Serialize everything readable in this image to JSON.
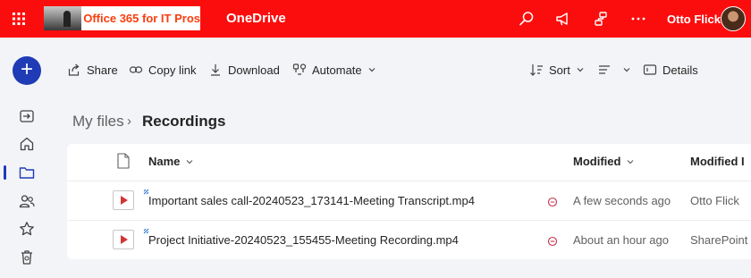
{
  "topbar": {
    "logo_text": "Office 365 for IT Pros",
    "app_title": "OneDrive",
    "user_name": "Otto Flick",
    "icons": [
      "waffle-icon",
      "search-icon",
      "megaphone-icon",
      "diagram-icon",
      "more-icon"
    ]
  },
  "rail": {
    "new_label": "+",
    "items": [
      "home-exit-icon",
      "home-icon",
      "folder-icon",
      "people-icon",
      "star-icon",
      "recycle-bin-icon"
    ]
  },
  "command_bar": {
    "share": "Share",
    "copy_link": "Copy link",
    "download": "Download",
    "automate": "Automate",
    "sort": "Sort",
    "details": "Details"
  },
  "breadcrumb": {
    "parent": "My files",
    "separator": "›",
    "current": "Recordings"
  },
  "list": {
    "columns": {
      "name": "Name",
      "modified": "Modified",
      "modified_by": "Modified I"
    },
    "rows": [
      {
        "name": "Important sales call-20240523_173141-Meeting Transcript.mp4",
        "modified": "A few seconds ago",
        "modified_by": "Otto Flick"
      },
      {
        "name": "Project Initiative-20240523_155455-Meeting Recording.mp4",
        "modified": "About an hour ago",
        "modified_by": "SharePoint"
      }
    ]
  },
  "colors": {
    "topbar": "#fc0d0d",
    "accent": "#1f3bb5",
    "background": "#f3f4f7"
  }
}
